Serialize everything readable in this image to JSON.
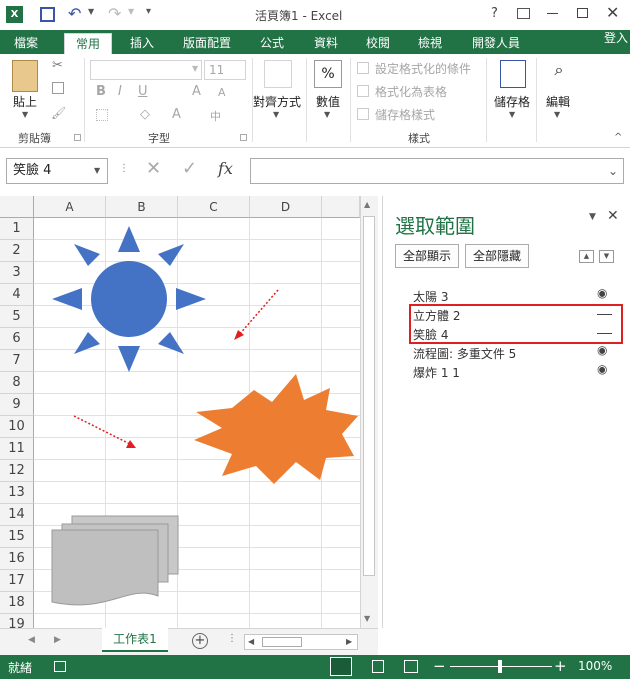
{
  "title": {
    "doc_title": "活頁簿1 - Excel",
    "help": "?",
    "login": "登入"
  },
  "ribbon_tabs": [
    "檔案",
    "常用",
    "插入",
    "版面配置",
    "公式",
    "資料",
    "校閱",
    "檢視",
    "開發人員"
  ],
  "ribbon": {
    "paste": "貼上",
    "clipboard_group": "剪貼簿",
    "font_size": "11",
    "font_group": "字型",
    "align": "對齊方式",
    "number": "數值",
    "percent": "%",
    "cond_format": "設定格式化的條件",
    "format_table": "格式化為表格",
    "cell_style": "儲存格樣式",
    "style_group": "樣式",
    "cells": "儲存格",
    "edit": "編輯"
  },
  "formula_bar": {
    "name_box": "笑臉 4",
    "fx": "fx",
    "formula": ""
  },
  "columns": [
    "A",
    "B",
    "C",
    "D"
  ],
  "rows": [
    "1",
    "2",
    "3",
    "4",
    "5",
    "6",
    "7",
    "8",
    "9",
    "10",
    "11",
    "12",
    "13",
    "14",
    "15",
    "16",
    "17",
    "18",
    "19"
  ],
  "selection_pane": {
    "title": "選取範圍",
    "show_all": "全部顯示",
    "hide_all": "全部隱藏",
    "items": [
      {
        "name": "太陽 3",
        "visible": true
      },
      {
        "name": "立方體 2",
        "visible": false
      },
      {
        "name": "笑臉 4",
        "visible": false
      },
      {
        "name": "流程圖: 多重文件 5",
        "visible": true
      },
      {
        "name": "爆炸 1 1",
        "visible": true
      }
    ]
  },
  "sheet_tab": "工作表1",
  "status": {
    "ready": "就緒",
    "zoom": "100%",
    "minus": "−",
    "plus": "+"
  },
  "colors": {
    "accent": "#217346",
    "sun": "#4472c4",
    "explosion": "#ed7d31",
    "document": "#bfbfbf",
    "highlight": "#e02020"
  }
}
